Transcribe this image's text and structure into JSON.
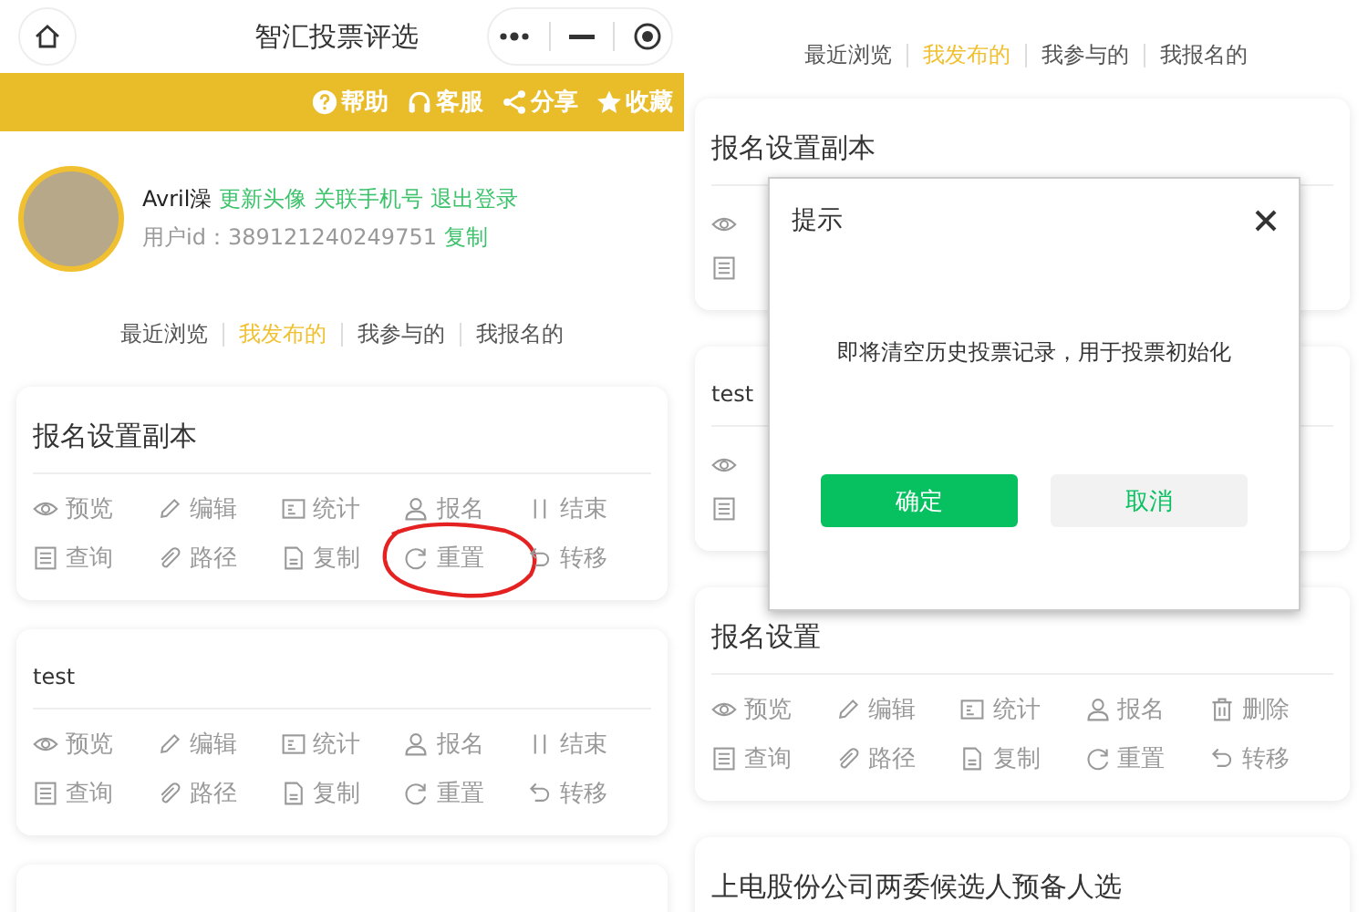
{
  "left": {
    "header": {
      "title": "智汇投票评选"
    },
    "toolbar": [
      {
        "kind": "help",
        "label": "帮助"
      },
      {
        "kind": "headset",
        "label": "客服"
      },
      {
        "kind": "share",
        "label": "分享"
      },
      {
        "kind": "star",
        "label": "收藏"
      }
    ],
    "profile": {
      "name": "Avril澡",
      "links": [
        "更新头像",
        "关联手机号",
        "退出登录"
      ],
      "user_id": "用户id：389121240249751",
      "copy": "复制"
    },
    "tabs": [
      {
        "label": "最近浏览",
        "selected": false
      },
      {
        "label": "我发布的",
        "selected": true
      },
      {
        "label": "我参与的",
        "selected": false
      },
      {
        "label": "我报名的",
        "selected": false
      }
    ],
    "cards": [
      {
        "title": "报名设置副本",
        "actions": [
          {
            "kind": "eye",
            "label": "预览",
            "circled": false
          },
          {
            "kind": "pencil",
            "label": "编辑",
            "circled": false
          },
          {
            "kind": "stats",
            "label": "统计",
            "circled": false
          },
          {
            "kind": "person",
            "label": "报名",
            "circled": false
          },
          {
            "kind": "pause",
            "label": "结束",
            "circled": false
          },
          {
            "kind": "list",
            "label": "查询",
            "circled": false
          },
          {
            "kind": "clip",
            "label": "路径",
            "circled": false
          },
          {
            "kind": "file",
            "label": "复制",
            "circled": false
          },
          {
            "kind": "refresh",
            "label": "重置",
            "circled": true
          },
          {
            "kind": "undo",
            "label": "转移",
            "circled": false
          }
        ]
      },
      {
        "title": "test",
        "actions": [
          {
            "kind": "eye",
            "label": "预览",
            "circled": false
          },
          {
            "kind": "pencil",
            "label": "编辑",
            "circled": false
          },
          {
            "kind": "stats",
            "label": "统计",
            "circled": false
          },
          {
            "kind": "person",
            "label": "报名",
            "circled": false
          },
          {
            "kind": "pause",
            "label": "结束",
            "circled": false
          },
          {
            "kind": "list",
            "label": "查询",
            "circled": false
          },
          {
            "kind": "clip",
            "label": "路径",
            "circled": false
          },
          {
            "kind": "file",
            "label": "复制",
            "circled": false
          },
          {
            "kind": "refresh",
            "label": "重置",
            "circled": false
          },
          {
            "kind": "undo",
            "label": "转移",
            "circled": false
          }
        ]
      }
    ]
  },
  "right": {
    "tabs": [
      {
        "label": "最近浏览",
        "selected": false
      },
      {
        "label": "我发布的",
        "selected": true
      },
      {
        "label": "我参与的",
        "selected": false
      },
      {
        "label": "我报名的",
        "selected": false
      }
    ],
    "cards": [
      {
        "title": "报名设置副本"
      },
      {
        "title": "test"
      },
      {
        "title": "报名设置",
        "actions": [
          {
            "kind": "eye",
            "label": "预览",
            "circled": false
          },
          {
            "kind": "pencil",
            "label": "编辑",
            "circled": false
          },
          {
            "kind": "stats",
            "label": "统计",
            "circled": false
          },
          {
            "kind": "person",
            "label": "报名",
            "circled": false
          },
          {
            "kind": "trash",
            "label": "删除",
            "circled": false
          },
          {
            "kind": "list",
            "label": "查询",
            "circled": false
          },
          {
            "kind": "clip",
            "label": "路径",
            "circled": false
          },
          {
            "kind": "file",
            "label": "复制",
            "circled": false
          },
          {
            "kind": "refresh",
            "label": "重置",
            "circled": false
          },
          {
            "kind": "undo",
            "label": "转移",
            "circled": false
          }
        ]
      },
      {
        "title": "上电股份公司两委候选人预备人选"
      }
    ],
    "dialog": {
      "title": "提示",
      "message": "即将清空历史投票记录，用于投票初始化",
      "buttons": [
        {
          "kind": "primary",
          "label": "确定"
        },
        {
          "kind": "secondary",
          "label": "取消"
        }
      ]
    }
  }
}
